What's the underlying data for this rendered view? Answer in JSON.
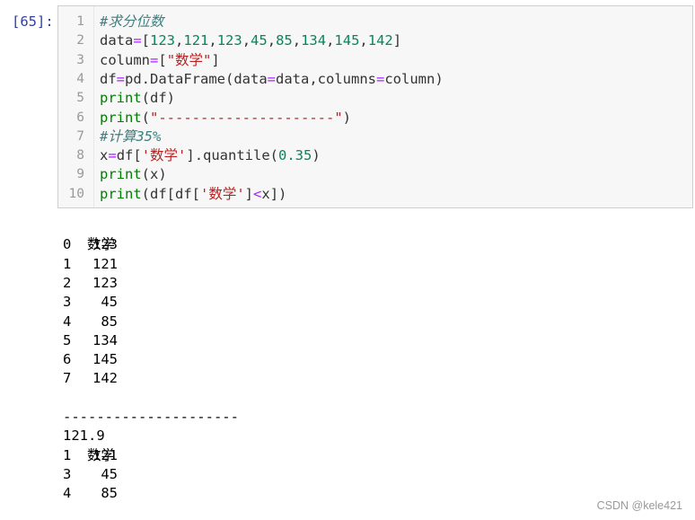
{
  "prompt": "[65]:",
  "code_lines": [
    {
      "no": "1",
      "tokens": [
        {
          "t": "#求分位数",
          "c": "t-cm"
        }
      ]
    },
    {
      "no": "2",
      "tokens": [
        {
          "t": "data",
          "c": "t-plain"
        },
        {
          "t": "=",
          "c": "t-op"
        },
        {
          "t": "[",
          "c": "t-plain"
        },
        {
          "t": "123",
          "c": "t-num"
        },
        {
          "t": ",",
          "c": "t-plain"
        },
        {
          "t": "121",
          "c": "t-num"
        },
        {
          "t": ",",
          "c": "t-plain"
        },
        {
          "t": "123",
          "c": "t-num"
        },
        {
          "t": ",",
          "c": "t-plain"
        },
        {
          "t": "45",
          "c": "t-num"
        },
        {
          "t": ",",
          "c": "t-plain"
        },
        {
          "t": "85",
          "c": "t-num"
        },
        {
          "t": ",",
          "c": "t-plain"
        },
        {
          "t": "134",
          "c": "t-num"
        },
        {
          "t": ",",
          "c": "t-plain"
        },
        {
          "t": "145",
          "c": "t-num"
        },
        {
          "t": ",",
          "c": "t-plain"
        },
        {
          "t": "142",
          "c": "t-num"
        },
        {
          "t": "]",
          "c": "t-plain"
        }
      ]
    },
    {
      "no": "3",
      "tokens": [
        {
          "t": "column",
          "c": "t-plain"
        },
        {
          "t": "=",
          "c": "t-op"
        },
        {
          "t": "[",
          "c": "t-plain"
        },
        {
          "t": "\"数学\"",
          "c": "t-str"
        },
        {
          "t": "]",
          "c": "t-plain"
        }
      ]
    },
    {
      "no": "4",
      "tokens": [
        {
          "t": "df",
          "c": "t-plain"
        },
        {
          "t": "=",
          "c": "t-op"
        },
        {
          "t": "pd.DataFrame(data",
          "c": "t-plain"
        },
        {
          "t": "=",
          "c": "t-op"
        },
        {
          "t": "data,columns",
          "c": "t-plain"
        },
        {
          "t": "=",
          "c": "t-op"
        },
        {
          "t": "column)",
          "c": "t-plain"
        }
      ]
    },
    {
      "no": "5",
      "tokens": [
        {
          "t": "print",
          "c": "t-kw"
        },
        {
          "t": "(df)",
          "c": "t-plain"
        }
      ]
    },
    {
      "no": "6",
      "tokens": [
        {
          "t": "print",
          "c": "t-kw"
        },
        {
          "t": "(",
          "c": "t-plain"
        },
        {
          "t": "\"---------------------\"",
          "c": "t-str"
        },
        {
          "t": ")",
          "c": "t-plain"
        }
      ]
    },
    {
      "no": "7",
      "tokens": [
        {
          "t": "#计算35%",
          "c": "t-cm"
        }
      ]
    },
    {
      "no": "8",
      "tokens": [
        {
          "t": "x",
          "c": "t-plain"
        },
        {
          "t": "=",
          "c": "t-op"
        },
        {
          "t": "df[",
          "c": "t-plain"
        },
        {
          "t": "'数学'",
          "c": "t-str"
        },
        {
          "t": "].quantile(",
          "c": "t-plain"
        },
        {
          "t": "0.35",
          "c": "t-num"
        },
        {
          "t": ")",
          "c": "t-plain"
        }
      ]
    },
    {
      "no": "9",
      "tokens": [
        {
          "t": "print",
          "c": "t-kw"
        },
        {
          "t": "(x)",
          "c": "t-plain"
        }
      ]
    },
    {
      "no": "10",
      "tokens": [
        {
          "t": "print",
          "c": "t-kw"
        },
        {
          "t": "(df[df[",
          "c": "t-plain"
        },
        {
          "t": "'数学'",
          "c": "t-str"
        },
        {
          "t": "]",
          "c": "t-plain"
        },
        {
          "t": "<",
          "c": "t-op"
        },
        {
          "t": "x])",
          "c": "t-plain"
        }
      ]
    }
  ],
  "output": {
    "table1": {
      "header": "数学",
      "rows": [
        {
          "index": "0",
          "value": "123"
        },
        {
          "index": "1",
          "value": "121"
        },
        {
          "index": "2",
          "value": "123"
        },
        {
          "index": "3",
          "value": "45"
        },
        {
          "index": "4",
          "value": "85"
        },
        {
          "index": "5",
          "value": "134"
        },
        {
          "index": "6",
          "value": "145"
        },
        {
          "index": "7",
          "value": "142"
        }
      ]
    },
    "separator": "---------------------",
    "quantile_value": "121.9",
    "table2": {
      "header": "数学",
      "rows": [
        {
          "index": "1",
          "value": "121"
        },
        {
          "index": "3",
          "value": "45"
        },
        {
          "index": "4",
          "value": "85"
        }
      ]
    }
  },
  "watermark": "CSDN @kele421"
}
